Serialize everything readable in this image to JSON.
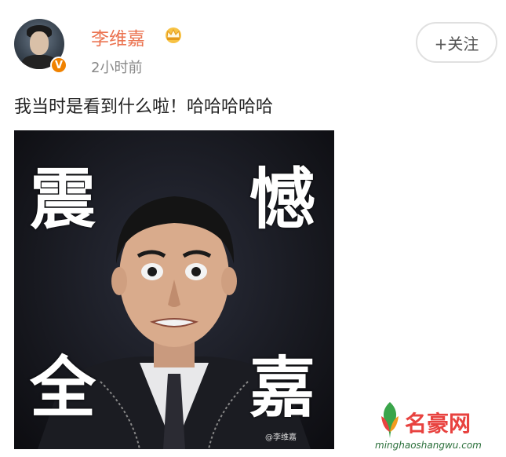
{
  "post": {
    "username": "李维嘉",
    "time": "2小时前",
    "follow_label": "+关注",
    "text": "我当时是看到什么啦！哈哈哈哈哈",
    "verified_badge": "V"
  },
  "meme": {
    "top_left": "震",
    "top_right": "憾",
    "bottom_left": "全",
    "bottom_right": "嘉",
    "watermark": "@李维嘉"
  },
  "site": {
    "name": "名豪网",
    "url": "minghaoshangwu.com"
  },
  "colors": {
    "username": "#eb7350",
    "badge": "#f08200",
    "site_red": "#e8423f"
  }
}
